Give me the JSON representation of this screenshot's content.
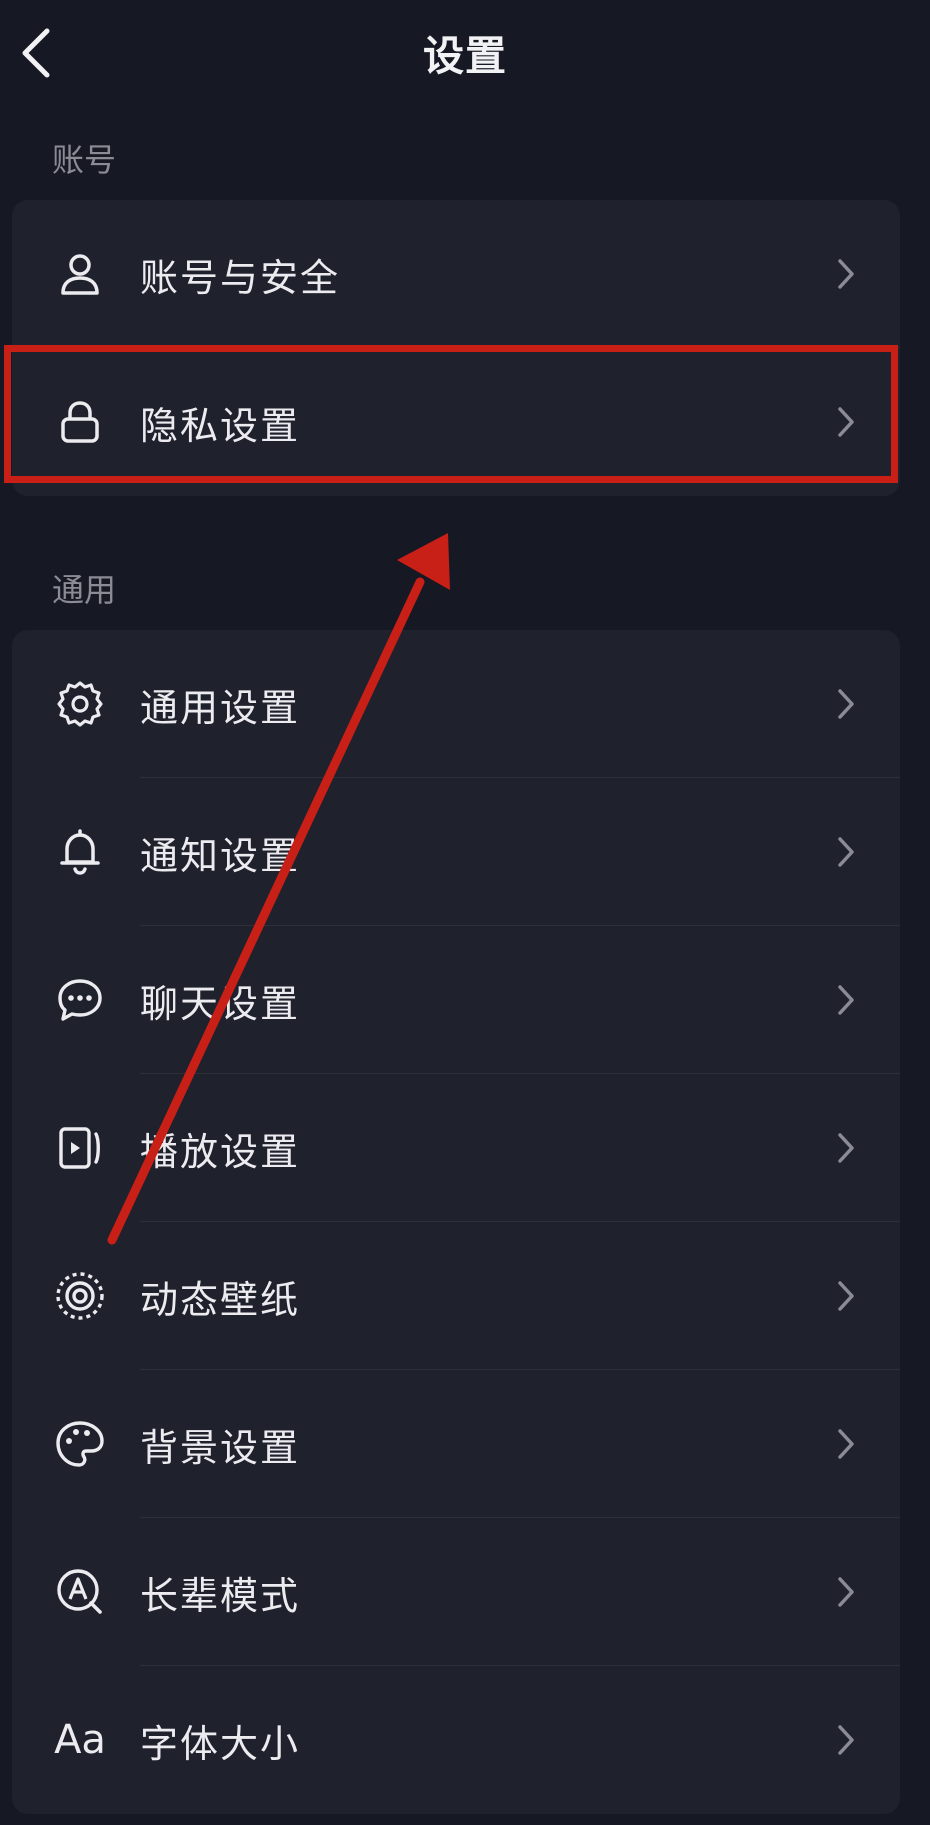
{
  "header": {
    "title": "设置",
    "back_icon": "chevron-left-icon"
  },
  "sections": [
    {
      "label": "账号",
      "items": [
        {
          "label": "账号与安全",
          "icon": "user-icon"
        },
        {
          "label": "隐私设置",
          "icon": "lock-icon",
          "highlighted": true
        }
      ]
    },
    {
      "label": "通用",
      "items": [
        {
          "label": "通用设置",
          "icon": "gear-icon"
        },
        {
          "label": "通知设置",
          "icon": "bell-icon"
        },
        {
          "label": "聊天设置",
          "icon": "chat-bubble-icon"
        },
        {
          "label": "播放设置",
          "icon": "play-screen-icon"
        },
        {
          "label": "动态壁纸",
          "icon": "dotted-circle-icon"
        },
        {
          "label": "背景设置",
          "icon": "palette-icon"
        },
        {
          "label": "长辈模式",
          "icon": "elder-mode-icon"
        },
        {
          "label": "字体大小",
          "icon": "font-size-icon",
          "icon_text": "Aa"
        }
      ]
    }
  ],
  "colors": {
    "background": "#161823",
    "card": "#1f212c",
    "text": "#ececf0",
    "muted": "#8a8b94",
    "annotation_red": "#c81f17"
  }
}
